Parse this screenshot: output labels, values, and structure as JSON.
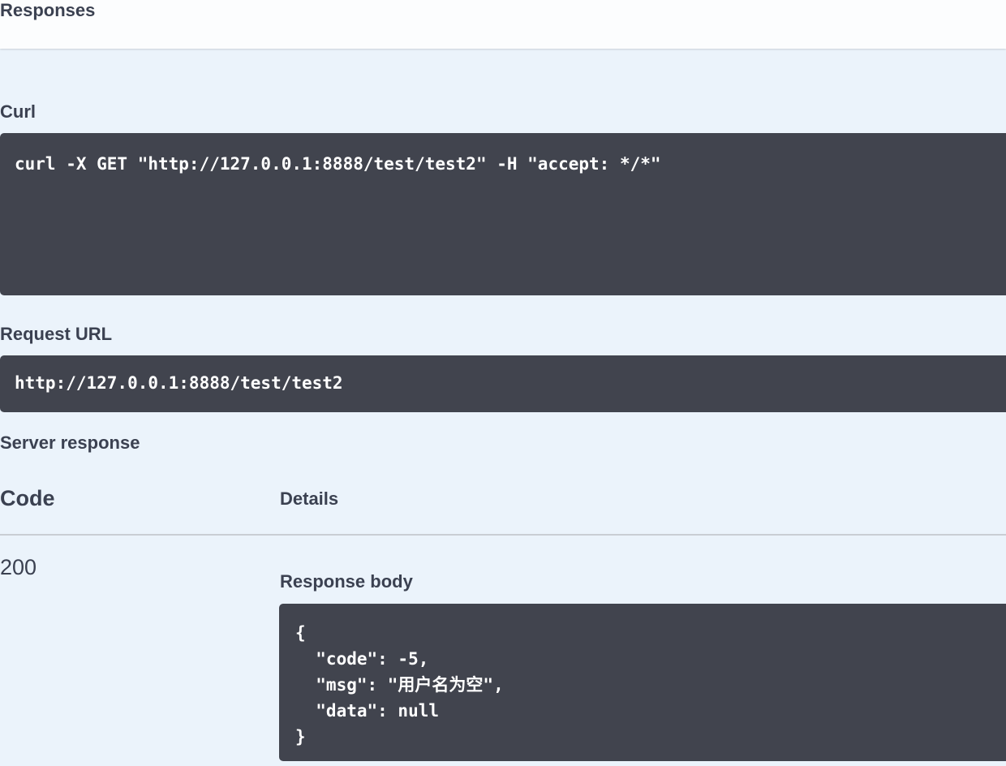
{
  "header": {
    "title": "Responses"
  },
  "curl": {
    "label": "Curl",
    "command": "curl -X GET \"http://127.0.0.1:8888/test/test2\" -H \"accept: */*\""
  },
  "request_url": {
    "label": "Request URL",
    "value": "http://127.0.0.1:8888/test/test2"
  },
  "server_response": {
    "label": "Server response",
    "columns": {
      "code": "Code",
      "details": "Details"
    },
    "code": "200",
    "body_label": "Response body",
    "body_lines": [
      "{",
      "  \"code\": -5,",
      "  \"msg\": \"用户名为空\",",
      "  \"data\": null",
      "}"
    ]
  }
}
